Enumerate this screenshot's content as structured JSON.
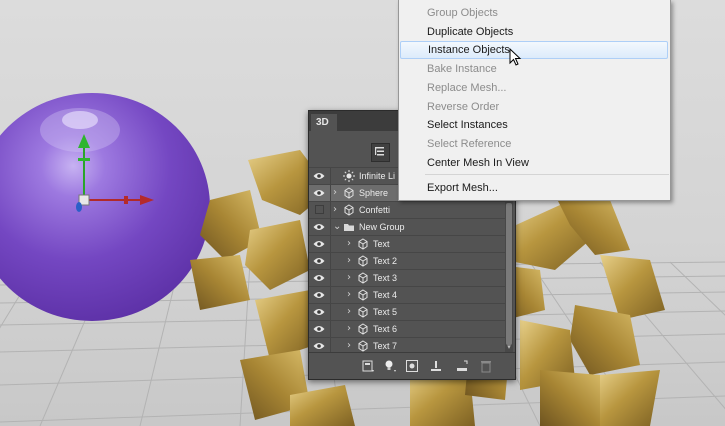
{
  "panel": {
    "tab_label": "3D",
    "layers": [
      {
        "name": "Infinite Li",
        "visible": true,
        "icon": "light-icon",
        "expander": false,
        "indent": 0,
        "selected": false
      },
      {
        "name": "Sphere",
        "visible": true,
        "icon": "mesh-icon",
        "expander": true,
        "indent": 0,
        "selected": true
      },
      {
        "name": "Confetti",
        "visible": false,
        "icon": "mesh-icon",
        "expander": true,
        "indent": 0,
        "selected": false
      },
      {
        "name": "New Group",
        "visible": true,
        "icon": "folder-icon",
        "expander": true,
        "expanded": true,
        "indent": 0,
        "selected": false
      },
      {
        "name": "Text",
        "visible": true,
        "icon": "mesh-icon",
        "expander": true,
        "indent": 1,
        "selected": false
      },
      {
        "name": "Text 2",
        "visible": true,
        "icon": "mesh-icon",
        "expander": true,
        "indent": 1,
        "selected": false
      },
      {
        "name": "Text 3",
        "visible": true,
        "icon": "mesh-icon",
        "expander": true,
        "indent": 1,
        "selected": false
      },
      {
        "name": "Text 4",
        "visible": true,
        "icon": "mesh-icon",
        "expander": true,
        "indent": 1,
        "selected": false
      },
      {
        "name": "Text 5",
        "visible": true,
        "icon": "mesh-icon",
        "expander": true,
        "indent": 1,
        "selected": false
      },
      {
        "name": "Text 6",
        "visible": true,
        "icon": "mesh-icon",
        "expander": true,
        "indent": 1,
        "selected": false
      },
      {
        "name": "Text 7",
        "visible": true,
        "icon": "mesh-icon",
        "expander": true,
        "indent": 1,
        "selected": false
      }
    ],
    "bottom_icons": [
      "mesh-menu-icon",
      "light-menu-icon",
      "render-icon",
      "drop-to-ground-icon",
      "add-constraint-icon",
      "trash-icon"
    ]
  },
  "menu": {
    "items": [
      {
        "label": "Group Objects",
        "disabled": true
      },
      {
        "label": "Duplicate Objects",
        "disabled": false
      },
      {
        "label": "Instance Objects",
        "disabled": false,
        "highlighted": true
      },
      {
        "label": "Bake Instance",
        "disabled": true
      },
      {
        "label": "Replace Mesh...",
        "disabled": true
      },
      {
        "label": "Reverse Order",
        "disabled": true
      },
      {
        "label": "Select Instances",
        "disabled": false
      },
      {
        "label": "Select Reference",
        "disabled": true
      },
      {
        "label": "Center Mesh In View",
        "disabled": false
      },
      {
        "label": "Export Mesh...",
        "disabled": false,
        "separator_before": true
      }
    ]
  },
  "colors": {
    "sphere": "#7a4fc8",
    "gold": "#c2a24a",
    "panel_bg": "#535353",
    "menu_bg": "#f0f0f0"
  }
}
